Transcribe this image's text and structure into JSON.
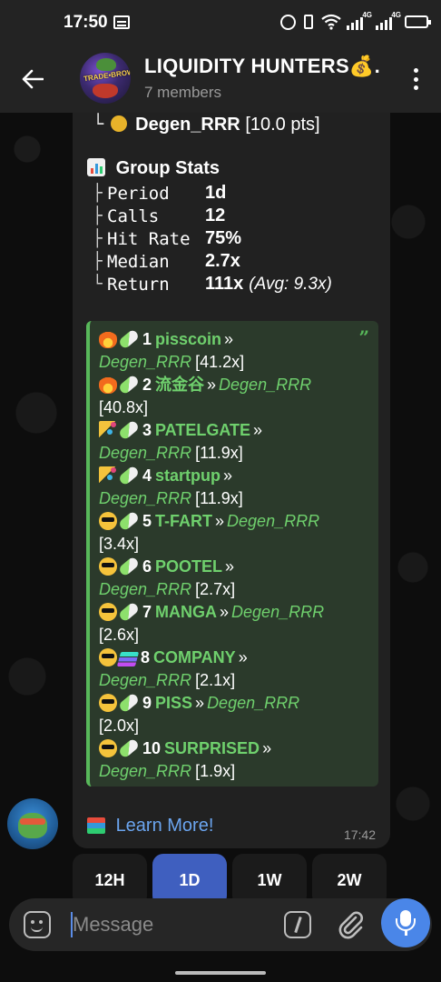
{
  "status_bar": {
    "time": "17:50",
    "network_label_1": "4G",
    "network_label_2": "4G"
  },
  "header": {
    "title": "LIQUIDITY HUNTERS💰.",
    "subtitle": "7 members",
    "avatar_text": "TRADE•BROWAN"
  },
  "message": {
    "top_rank": {
      "tree": "└",
      "name": "Degen_RRR",
      "points": "[10.0 pts]"
    },
    "stats_title": "Group Stats",
    "stats": [
      {
        "tree": "├",
        "label": "Period",
        "value": "1d",
        "extra": ""
      },
      {
        "tree": "├",
        "label": "Calls",
        "value": "12",
        "extra": ""
      },
      {
        "tree": "├",
        "label": "Hit Rate",
        "value": "75%",
        "extra": ""
      },
      {
        "tree": "├",
        "label": "Median",
        "value": "2.7x",
        "extra": ""
      },
      {
        "tree": "└",
        "label": "Return",
        "value": "111x",
        "extra": "(Avg: 9.3x)"
      }
    ],
    "quote_mark": "”",
    "calls": [
      {
        "icon": "fire",
        "chain": "pill",
        "rank": "1",
        "token": "pisscoin",
        "sep": "»",
        "caller": "Degen_RRR",
        "mult": "[41.2x]"
      },
      {
        "icon": "fire",
        "chain": "pill",
        "rank": "2",
        "token": "流金谷",
        "sep": "»",
        "caller": "Degen_RRR",
        "mult": "[40.8x]"
      },
      {
        "icon": "party",
        "chain": "pill",
        "rank": "3",
        "token": "PATELGATE",
        "sep": "»",
        "caller": "Degen_RRR",
        "mult": "[11.9x]"
      },
      {
        "icon": "party",
        "chain": "pill",
        "rank": "4",
        "token": "startpup",
        "sep": "»",
        "caller": "Degen_RRR",
        "mult": "[11.9x]"
      },
      {
        "icon": "cool",
        "chain": "pill",
        "rank": "5",
        "token": "T-FART",
        "sep": "»",
        "caller": "Degen_RRR",
        "mult": "[3.4x]"
      },
      {
        "icon": "cool",
        "chain": "pill",
        "rank": "6",
        "token": "POOTEL",
        "sep": "»",
        "caller": "Degen_RRR",
        "mult": "[2.7x]"
      },
      {
        "icon": "cool",
        "chain": "pill",
        "rank": "7",
        "token": "MANGA",
        "sep": "»",
        "caller": "Degen_RRR",
        "mult": "[2.6x]"
      },
      {
        "icon": "cool",
        "chain": "solana",
        "rank": "8",
        "token": "COMPANY",
        "sep": "»",
        "caller": "Degen_RRR",
        "mult": "[2.1x]"
      },
      {
        "icon": "cool",
        "chain": "pill",
        "rank": "9",
        "token": "PISS",
        "sep": "»",
        "caller": "Degen_RRR",
        "mult": "[2.0x]"
      },
      {
        "icon": "cool",
        "chain": "pill",
        "rank": "10",
        "token": "SURPRISED",
        "sep": "»",
        "caller": "Degen_RRR",
        "mult": "[1.9x]"
      }
    ],
    "learn_more": "Learn More!",
    "time": "17:42"
  },
  "timeframes": [
    {
      "label": "12H",
      "active": false
    },
    {
      "label": "1D",
      "active": true
    },
    {
      "label": "1W",
      "active": false
    },
    {
      "label": "2W",
      "active": false
    }
  ],
  "composer": {
    "placeholder": "Message"
  },
  "colors": {
    "accent": "#4a86e8",
    "link": "#6ba5ef",
    "quote_green": "#58b85a",
    "active_tab": "#3f5fbf"
  }
}
